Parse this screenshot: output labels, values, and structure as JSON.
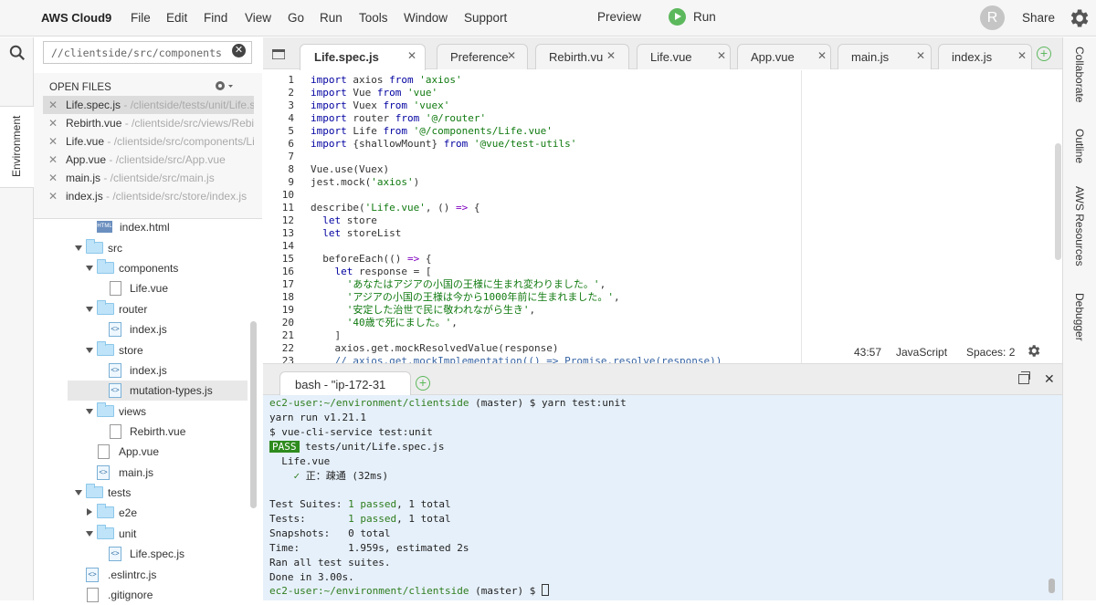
{
  "menubar": {
    "logo": "AWS Cloud9",
    "menus": [
      "File",
      "Edit",
      "Find",
      "View",
      "Go",
      "Run",
      "Tools",
      "Window",
      "Support"
    ],
    "preview": "Preview",
    "run": "Run",
    "avatar": "R",
    "share": "Share"
  },
  "left_strip": {
    "environment_tab": "Environment"
  },
  "sidebar": {
    "search_value": "//clientside/src/components",
    "open_files_header": "OPEN FILES",
    "open_files": [
      {
        "name": "Life.spec.js",
        "path": " - /clientside/tests/unit/Life.sp"
      },
      {
        "name": "Rebirth.vue",
        "path": " - /clientside/src/views/Rebirtl"
      },
      {
        "name": "Life.vue",
        "path": " - /clientside/src/components/Life"
      },
      {
        "name": "App.vue",
        "path": " - /clientside/src/App.vue"
      },
      {
        "name": "main.js",
        "path": " - /clientside/src/main.js"
      },
      {
        "name": "index.js",
        "path": " - /clientside/src/store/index.js"
      }
    ],
    "tree": [
      {
        "label": "index.html"
      },
      {
        "label": "src"
      },
      {
        "label": "components"
      },
      {
        "label": "Life.vue"
      },
      {
        "label": "router"
      },
      {
        "label": "index.js"
      },
      {
        "label": "store"
      },
      {
        "label": "index.js"
      },
      {
        "label": "mutation-types.js"
      },
      {
        "label": "views"
      },
      {
        "label": "Rebirth.vue"
      },
      {
        "label": "App.vue"
      },
      {
        "label": "main.js"
      },
      {
        "label": "tests"
      },
      {
        "label": "e2e"
      },
      {
        "label": "unit"
      },
      {
        "label": "Life.spec.js"
      },
      {
        "label": ".eslintrc.js"
      },
      {
        "label": ".gitignore"
      }
    ]
  },
  "editor": {
    "tabs": [
      "Life.spec.js",
      "Preference",
      "Rebirth.vu",
      "Life.vue",
      "App.vue",
      "main.js",
      "index.js"
    ],
    "line_numbers": [
      "1",
      "2",
      "3",
      "4",
      "5",
      "6",
      "7",
      "8",
      "9",
      "10",
      "11",
      "12",
      "13",
      "14",
      "15",
      "16",
      "17",
      "18",
      "19",
      "20",
      "21",
      "22",
      "23"
    ],
    "status": {
      "position": "43:57",
      "language": "JavaScript",
      "spaces": "Spaces: 2"
    }
  },
  "terminal": {
    "tab_label": "bash - \"ip-172-31",
    "lines": {
      "l1_user": "ec2-user:~/environment/clientside",
      "l1_rest": " (master) $ yarn test:unit",
      "l2": "yarn run v1.21.1",
      "l3": "$ vue-cli-service test:unit",
      "l4_badge": "PASS",
      "l4_rest": " tests/unit/Life.spec.js",
      "l5": "  Life.vue",
      "l6_check": "    ✓",
      "l6_rest": " 正：疎通 (32ms)",
      "l8_label": "Test Suites: ",
      "l8_green": "1 passed",
      "l8_rest": ", 1 total",
      "l9_label": "Tests:       ",
      "l9_green": "1 passed",
      "l9_rest": ", 1 total",
      "l10": "Snapshots:   0 total",
      "l11": "Time:        1.959s, estimated 2s",
      "l12": "Ran all test suites.",
      "l13": "Done in 3.00s.",
      "l14_user": "ec2-user:~/environment/clientside",
      "l14_rest": " (master) $ "
    }
  },
  "right_strip": {
    "tabs": [
      "Collaborate",
      "Outline",
      "AWS Resources",
      "Debugger"
    ]
  }
}
